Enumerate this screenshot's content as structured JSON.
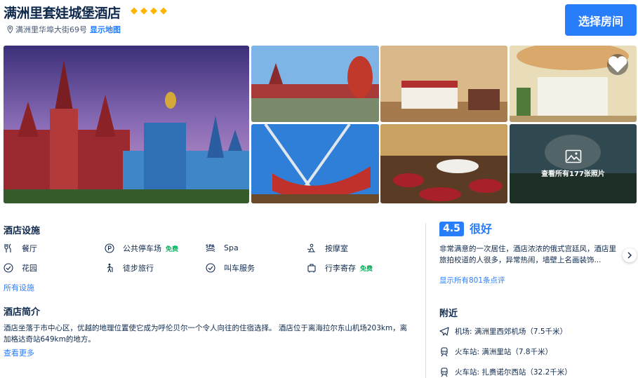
{
  "hotel": {
    "name": "满洲里套娃城堡酒店",
    "star_count": 4,
    "address": "满洲里华埠大街69号",
    "show_map": "显示地图",
    "select_room": "选择房间"
  },
  "gallery": {
    "see_all": "查看所有177张照片"
  },
  "facilities": {
    "title": "酒店设施",
    "items": [
      {
        "label": "餐厅",
        "icon": "restaurant-icon",
        "free": ""
      },
      {
        "label": "公共停车场",
        "icon": "parking-icon",
        "free": "免费"
      },
      {
        "label": "Spa",
        "icon": "spa-icon",
        "free": ""
      },
      {
        "label": "按摩室",
        "icon": "massage-icon",
        "free": ""
      },
      {
        "label": "花园",
        "icon": "check-circle-icon",
        "free": ""
      },
      {
        "label": "徒步旅行",
        "icon": "hiking-icon",
        "free": ""
      },
      {
        "label": "叫车服务",
        "icon": "check-circle-icon",
        "free": ""
      },
      {
        "label": "行李寄存",
        "icon": "luggage-icon",
        "free": "免费"
      }
    ],
    "all_link": "所有设施"
  },
  "intro": {
    "title": "酒店简介",
    "text": "酒店坐落于市中心区，优越的地理位置使它成为呼伦贝尔一个令人向往的住宿选择。 酒店位于离海拉尔东山机场203km，离加格达奇站649km的地方。",
    "see_more": "查看更多"
  },
  "reviews": {
    "score": "4.5",
    "score_word": "很好",
    "excerpt": "非常满意的一次居住，酒店浓浓的俄式宫廷风，酒店里旅拍校道的人很多，异常热闹，墙壁上名画装饰...",
    "all_link": "显示所有801条点评"
  },
  "nearby": {
    "title": "附近",
    "items": [
      {
        "label": "机场: 满洲里西郊机场（7.5千米）",
        "icon": "plane-icon"
      },
      {
        "label": "火车站: 满洲里站（7.8千米）",
        "icon": "train-icon"
      },
      {
        "label": "火车站: 扎赉诺尔西站（32.2千米）",
        "icon": "train-icon"
      }
    ]
  },
  "colors": {
    "accent": "#287dfa",
    "text": "#0f294d",
    "star": "#ffb400",
    "free": "#06ae5b"
  }
}
